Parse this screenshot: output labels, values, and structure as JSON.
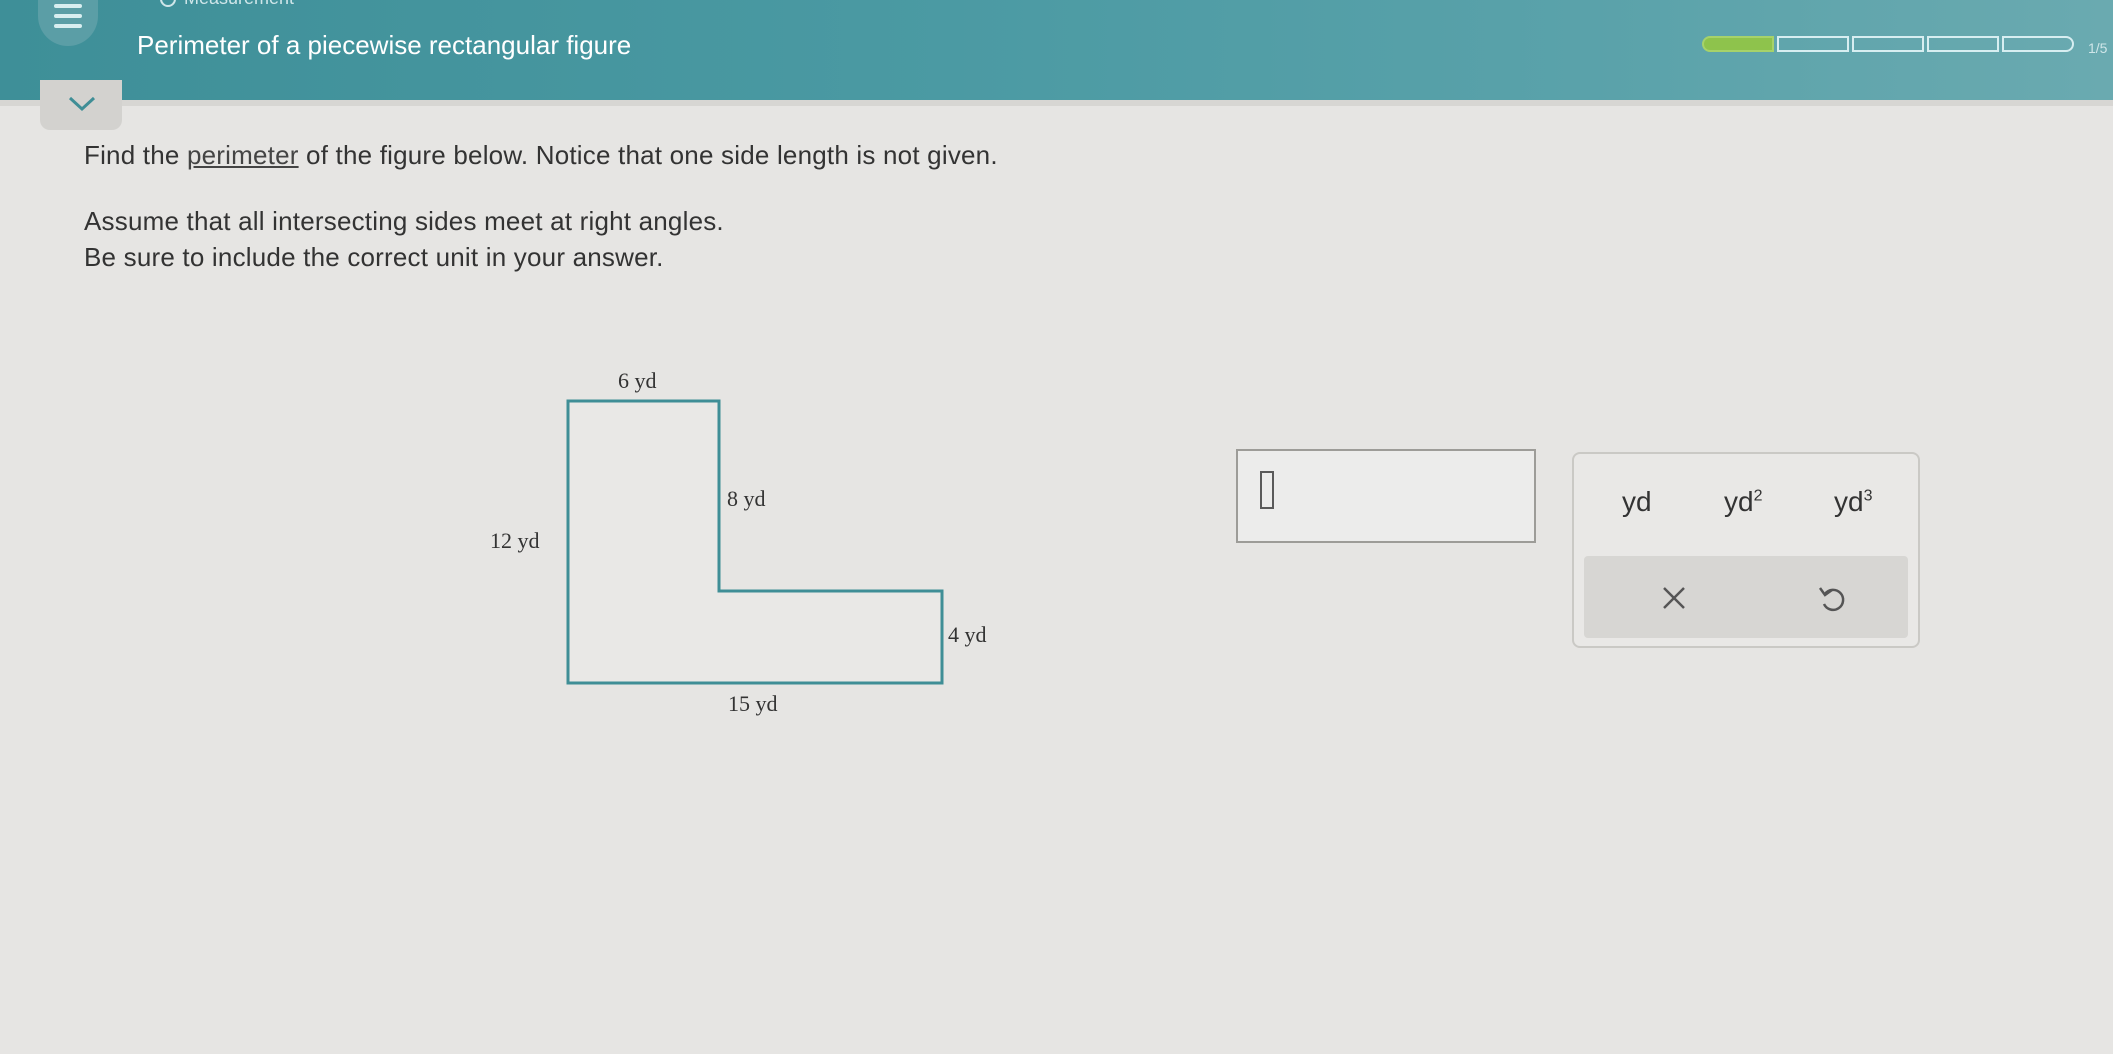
{
  "header": {
    "breadcrumb": "Measurement",
    "title": "Perimeter of a piecewise rectangular figure",
    "progress": {
      "completed": 1,
      "total": 5,
      "label": "1/5"
    }
  },
  "prompt": {
    "line1_before": "Find the ",
    "line1_link": "perimeter",
    "line1_after": " of the figure below. Notice that one side length is not given.",
    "line2": "Assume that all intersecting sides meet at right angles.",
    "line3": "Be sure to include the correct unit in your answer."
  },
  "figure": {
    "labels": {
      "top": "6 yd",
      "inner_vertical": "8 yd",
      "left": "12 yd",
      "right": "4 yd",
      "bottom": "15 yd"
    },
    "stroke_color": "#3f8e96"
  },
  "answer": {
    "value": ""
  },
  "units": {
    "yd": "yd",
    "yd2_base": "yd",
    "yd2_exp": "2",
    "yd3_base": "yd",
    "yd3_exp": "3"
  },
  "icons": {
    "menu": "hamburger-icon",
    "collapse": "chevron-down-icon",
    "clear": "close-icon",
    "undo": "undo-icon"
  },
  "colors": {
    "header": "#4b9aa3",
    "progress_fill": "#8ec34c",
    "background": "#e6e5e3"
  }
}
